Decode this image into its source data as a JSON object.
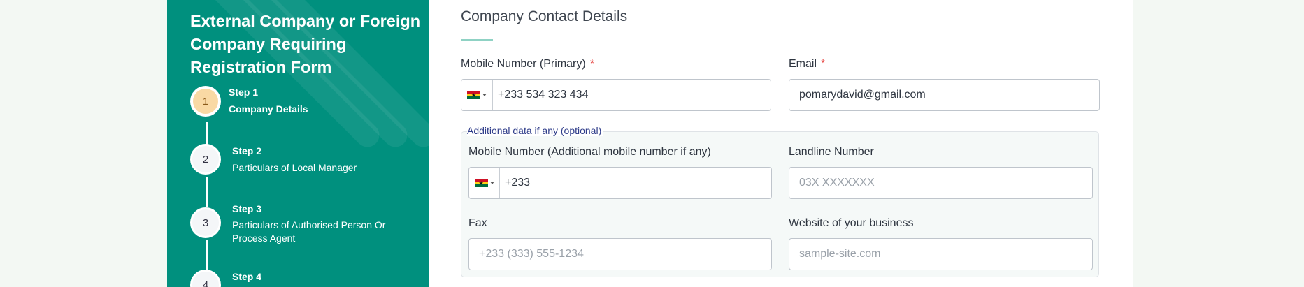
{
  "sidebar": {
    "form_title": "External Company or Foreign Company Requiring Registration Form",
    "steps": [
      {
        "number": "1",
        "label": "Step 1",
        "name": "Company Details",
        "active": true
      },
      {
        "number": "2",
        "label": "Step 2",
        "name": "Particulars of Local Manager",
        "active": false
      },
      {
        "number": "3",
        "label": "Step 3",
        "name": "Particulars of Authorised Person Or Process Agent",
        "active": false
      },
      {
        "number": "4",
        "label": "Step 4",
        "name": "",
        "active": false
      }
    ]
  },
  "main": {
    "section_title": "Company Contact Details",
    "required_marker": "*",
    "mobile_primary": {
      "label": "Mobile Number (Primary)",
      "value": "+233 534 323 434",
      "country": "Ghana"
    },
    "email": {
      "label": "Email",
      "value": "pomarydavid@gmail.com"
    },
    "additional": {
      "legend": "Additional data if any (optional)",
      "mobile_additional": {
        "label": "Mobile Number (Additional mobile number if any)",
        "value": "+233",
        "country": "Ghana"
      },
      "landline": {
        "label": "Landline Number",
        "placeholder": "03X XXXXXXX",
        "value": ""
      },
      "fax": {
        "label": "Fax",
        "placeholder": "+233 (333) 555-1234",
        "value": ""
      },
      "website": {
        "label": "Website of your business",
        "placeholder": "sample-site.com",
        "value": ""
      }
    }
  },
  "colors": {
    "sidebar_bg": "#00907e",
    "active_step": "#f9d9a4",
    "required": "#e53935",
    "legend_text": "#2f3d8a",
    "flag_red": "#ce1126",
    "flag_gold": "#fcd116",
    "flag_green": "#006b3f"
  },
  "icons": {
    "country_flag": "ghana-flag-icon",
    "dropdown": "caret-down-icon"
  }
}
